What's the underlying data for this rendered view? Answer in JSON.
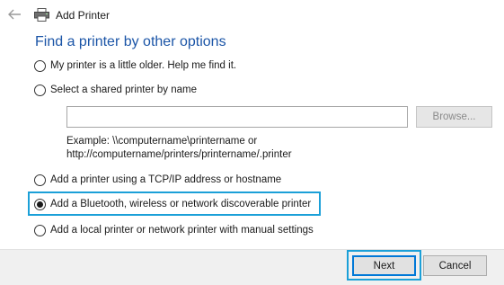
{
  "window": {
    "title": "Add Printer"
  },
  "icons": {
    "back": "back-arrow-icon",
    "printer": "printer-icon"
  },
  "page": {
    "heading": "Find a printer by other options"
  },
  "options": [
    {
      "label": "My printer is a little older. Help me find it.",
      "checked": false
    },
    {
      "label": "Select a shared printer by name",
      "checked": false
    },
    {
      "label": "Add a printer using a TCP/IP address or hostname",
      "checked": false
    },
    {
      "label": "Add a Bluetooth, wireless or network discoverable printer",
      "checked": true
    },
    {
      "label": "Add a local printer or network printer with manual settings",
      "checked": false
    }
  ],
  "shared_printer": {
    "input_value": "",
    "browse_label": "Browse...",
    "example_line1": "Example: \\\\computername\\printername or",
    "example_line2": "http://computername/printers/printername/.printer"
  },
  "buttons": {
    "next": "Next",
    "cancel": "Cancel"
  },
  "colors": {
    "heading": "#1b55a7",
    "highlight": "#1ba0d8",
    "footer_bg": "#f0f0f0"
  }
}
